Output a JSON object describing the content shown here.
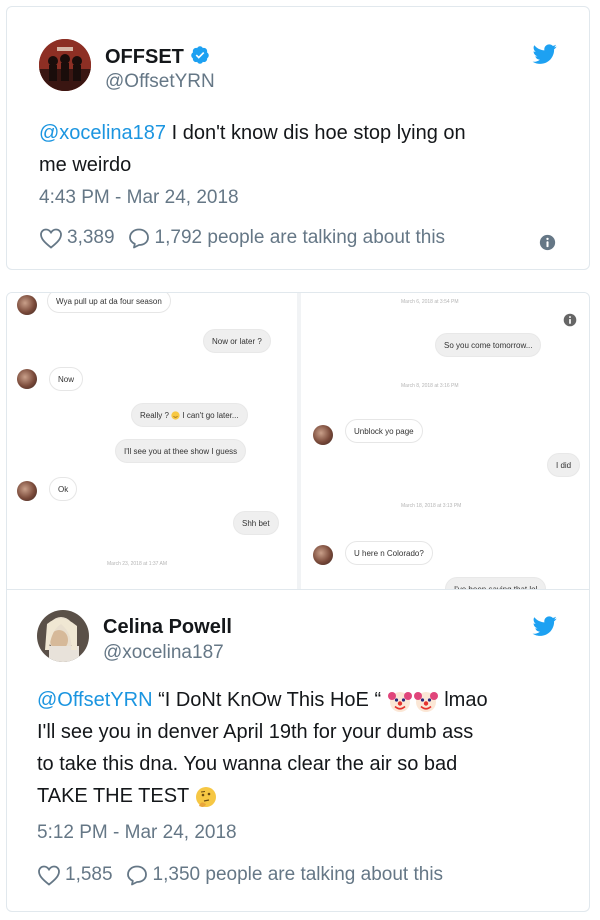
{
  "tweet1": {
    "name": "OFFSET",
    "handle": "@OffsetYRN",
    "mention": "@xocelina187",
    "text_line1_rest": " I don't know dis hoe stop lying on",
    "text_line2": "me weirdo",
    "timestamp": "4:43 PM - Mar 24, 2018",
    "likes": "3,389",
    "replies": "1,792 people are talking about this"
  },
  "screens": {
    "left": {
      "msg1": "Wya pull up at da four season",
      "msg2": "Now or later ?",
      "msg3": "Now",
      "msg4a": "Really ?",
      "msg4b": "I can't go later...",
      "msg5": "I'll see you at thee show I guess",
      "msg6": "Ok",
      "msg7": "Shh bet",
      "ts1": "March 23, 2018 at 1:37 AM"
    },
    "right": {
      "ts1": "March 6, 2018 at 3:54 PM",
      "msg1": "So you come tomorrow...",
      "ts2": "March 8, 2018 at 3:16 PM",
      "msg2": "Unblock yo page",
      "msg3": "I did",
      "ts3": "March 18, 2018 at 3:13 PM",
      "msg4": "U here n Colorado?",
      "msg5": "I've been saying that lol"
    }
  },
  "tweet2": {
    "name": "Celina Powell",
    "handle": "@xocelina187",
    "mention": "@OffsetYRN",
    "line1_rest": " “I DoNt KnOw This HoE “",
    "line1_end": " lmao",
    "line2": "I'll see you in denver April 19th for your dumb ass",
    "line3": "to take this dna. You wanna clear the air so bad",
    "line4": "TAKE THE TEST",
    "timestamp": "5:12 PM - Mar 24, 2018",
    "likes": "1,585",
    "replies": "1,350 people are talking about this"
  },
  "colors": {
    "link": "#1b95e0",
    "text": "#14171a",
    "muted": "#657786",
    "verified": "#1da1f2"
  },
  "icons": [
    "verified-icon",
    "twitter-bird-icon",
    "heart-icon",
    "speech-bubble-icon",
    "info-icon",
    "clown-emoji",
    "thinking-emoji"
  ]
}
